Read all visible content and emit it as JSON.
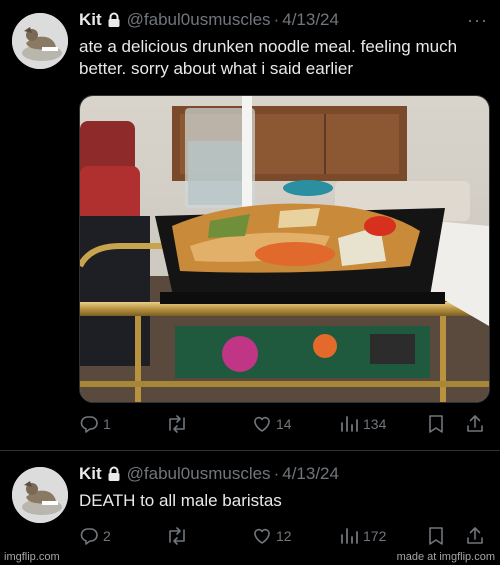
{
  "tweets": [
    {
      "name": "Kit",
      "handle": "@fabul0usmuscles",
      "separator": "·",
      "date": "4/13/24",
      "more": "···",
      "text": "ate a delicious drunken noodle meal. feeling much better. sorry about what i said earlier",
      "has_image": true,
      "replies": "1",
      "retweets": "",
      "likes": "14",
      "views": "134"
    },
    {
      "name": "Kit",
      "handle": "@fabul0usmuscles",
      "separator": "·",
      "date": "4/13/24",
      "text": "DEATH to all male baristas",
      "replies": "2",
      "retweets": "",
      "likes": "12",
      "views": "172"
    }
  ],
  "watermark": {
    "left": "imgflip.com",
    "right": "made at imgflip.com"
  },
  "icons": [
    "lock-icon",
    "more-icon",
    "reply-icon",
    "retweet-icon",
    "like-icon",
    "views-icon",
    "bookmark-icon",
    "share-icon"
  ],
  "colors": {
    "background": "#000000",
    "text": "#e7e9ea",
    "muted": "#71767b",
    "divider": "#2f3336"
  }
}
